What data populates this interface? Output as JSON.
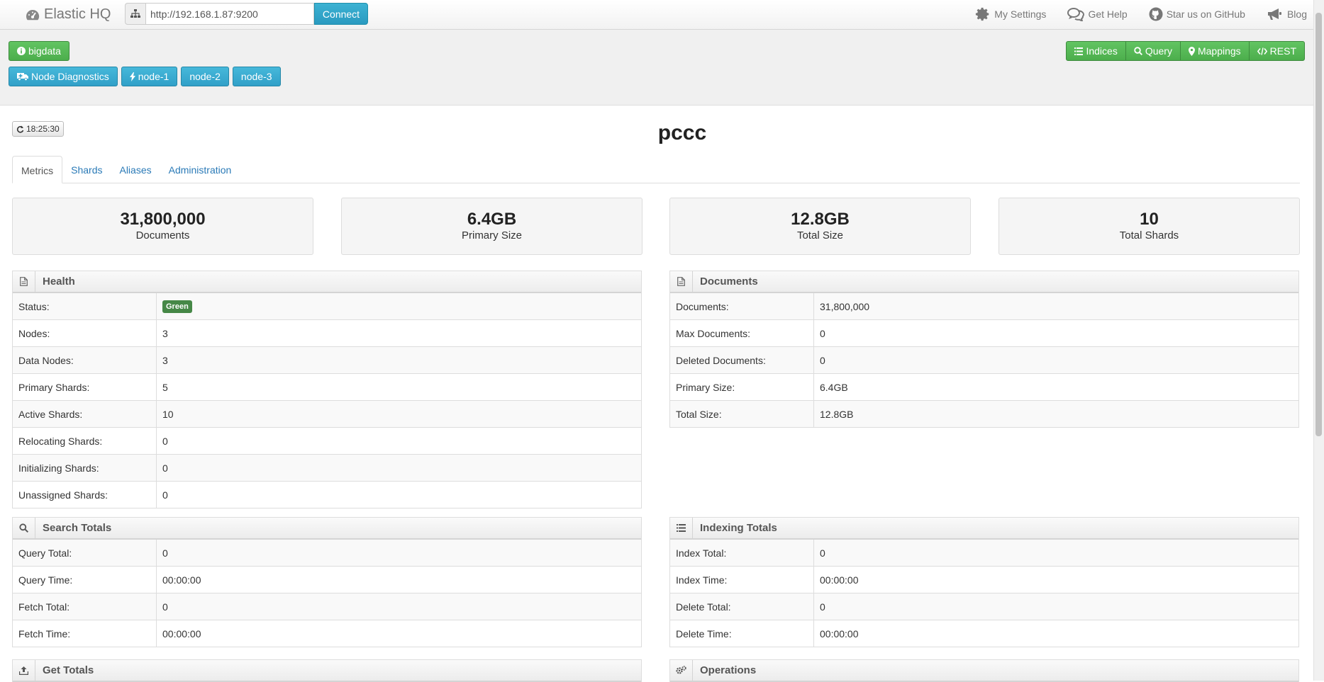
{
  "navbar": {
    "brand": "Elastic HQ",
    "url_value": "http://192.168.1.87:9200",
    "connect_label": "Connect",
    "links": [
      {
        "label": "My Settings",
        "icon": "gear-icon"
      },
      {
        "label": "Get Help",
        "icon": "chat-icon"
      },
      {
        "label": "Star us on GitHub",
        "icon": "github-icon"
      },
      {
        "label": "Blog",
        "icon": "bullhorn-icon"
      }
    ]
  },
  "cluster": {
    "name": "bigdata"
  },
  "nodes": {
    "diagnostics_label": "Node Diagnostics",
    "items": [
      "node-1",
      "node-2",
      "node-3"
    ]
  },
  "main_nav": {
    "indices": "Indices",
    "query": "Query",
    "mappings": "Mappings",
    "rest": "REST"
  },
  "refresh": {
    "time": "18:25:30"
  },
  "index": {
    "name": "pccc"
  },
  "tabs": [
    "Metrics",
    "Shards",
    "Aliases",
    "Administration"
  ],
  "stats": [
    {
      "value": "31,800,000",
      "label": "Documents"
    },
    {
      "value": "6.4GB",
      "label": "Primary Size"
    },
    {
      "value": "12.8GB",
      "label": "Total Size"
    },
    {
      "value": "10",
      "label": "Total Shards"
    }
  ],
  "health": {
    "title": "Health",
    "status_label": "Status:",
    "status_value": "Green",
    "status_color": "#468847",
    "rows": [
      {
        "k": "Nodes:",
        "v": "3"
      },
      {
        "k": "Data Nodes:",
        "v": "3"
      },
      {
        "k": "Primary Shards:",
        "v": "5"
      },
      {
        "k": "Active Shards:",
        "v": "10"
      },
      {
        "k": "Relocating Shards:",
        "v": "0"
      },
      {
        "k": "Initializing Shards:",
        "v": "0"
      },
      {
        "k": "Unassigned Shards:",
        "v": "0"
      }
    ]
  },
  "documents": {
    "title": "Documents",
    "rows": [
      {
        "k": "Documents:",
        "v": "31,800,000"
      },
      {
        "k": "Max Documents:",
        "v": "0"
      },
      {
        "k": "Deleted Documents:",
        "v": "0"
      },
      {
        "k": "Primary Size:",
        "v": "6.4GB"
      },
      {
        "k": "Total Size:",
        "v": "12.8GB"
      }
    ]
  },
  "search": {
    "title": "Search Totals",
    "rows": [
      {
        "k": "Query Total:",
        "v": "0"
      },
      {
        "k": "Query Time:",
        "v": "00:00:00"
      },
      {
        "k": "Fetch Total:",
        "v": "0"
      },
      {
        "k": "Fetch Time:",
        "v": "00:00:00"
      }
    ]
  },
  "indexing": {
    "title": "Indexing Totals",
    "rows": [
      {
        "k": "Index Total:",
        "v": "0"
      },
      {
        "k": "Index Time:",
        "v": "00:00:00"
      },
      {
        "k": "Delete Total:",
        "v": "0"
      },
      {
        "k": "Delete Time:",
        "v": "00:00:00"
      }
    ]
  },
  "get_totals": {
    "title": "Get Totals"
  },
  "operations": {
    "title": "Operations"
  },
  "colors": {
    "accent_green": "#5cb85c",
    "accent_blue": "#3cb2d3",
    "link": "#2a7ab7"
  }
}
